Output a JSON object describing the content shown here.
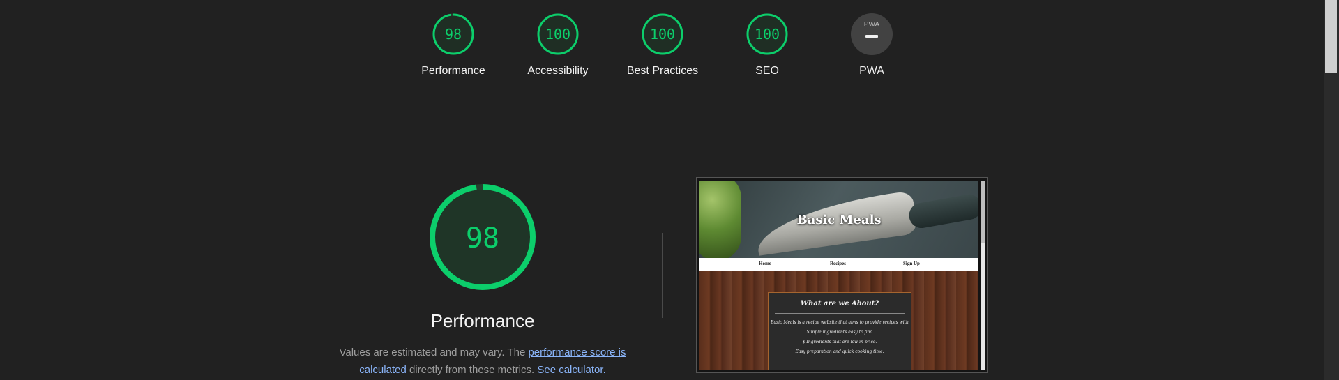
{
  "categories": [
    {
      "label": "Performance",
      "score": "98",
      "score_value": 98,
      "type": "gauge"
    },
    {
      "label": "Accessibility",
      "score": "100",
      "score_value": 100,
      "type": "gauge"
    },
    {
      "label": "Best Practices",
      "score": "100",
      "score_value": 100,
      "type": "gauge"
    },
    {
      "label": "SEO",
      "score": "100",
      "score_value": 100,
      "type": "gauge"
    },
    {
      "label": "PWA",
      "score": "",
      "type": "pwa-badge"
    }
  ],
  "pwa_badge_text": "PWA",
  "main": {
    "score": "98",
    "score_value": 98,
    "title": "Performance",
    "desc_prefix": "Values are estimated and may vary. The ",
    "desc_link1": "performance score is calculated",
    "desc_middle": " directly from these metrics. ",
    "desc_link2": "See calculator."
  },
  "preview": {
    "site_title": "Basic Meals",
    "nav": [
      "Home",
      "Recipes",
      "Sign Up"
    ],
    "card_title": "What are we About?",
    "card_lines": [
      "Basic Meals is a recipe website that aims to provide recipes with",
      "Simple ingredients easy to find",
      "$ Ingredients that are low in price.",
      "Easy preparation and quick cooking time."
    ]
  },
  "colors": {
    "pass": "#0cce6b",
    "pass_bg": "#1f3527",
    "background": "#212121",
    "pwa_badge": "#424242"
  }
}
